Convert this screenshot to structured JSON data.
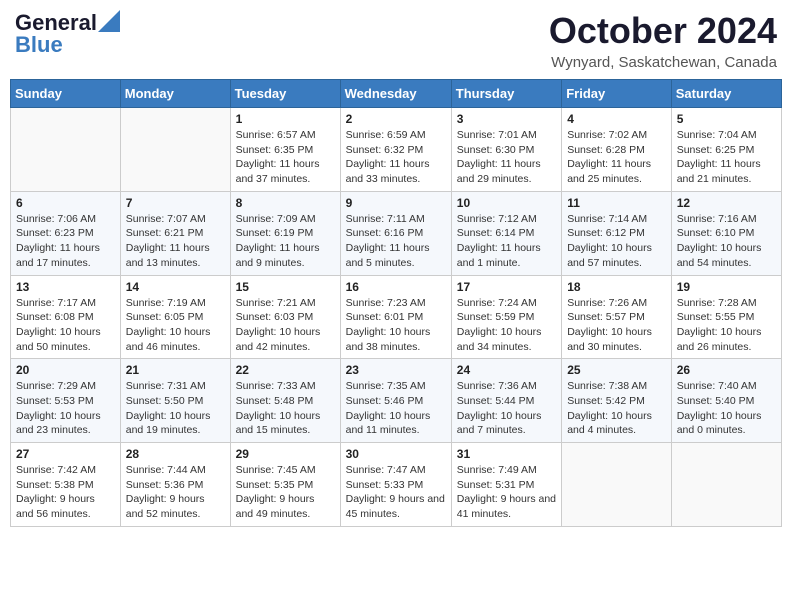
{
  "header": {
    "logo_general": "General",
    "logo_blue": "Blue",
    "month_title": "October 2024",
    "subtitle": "Wynyard, Saskatchewan, Canada"
  },
  "days_of_week": [
    "Sunday",
    "Monday",
    "Tuesday",
    "Wednesday",
    "Thursday",
    "Friday",
    "Saturday"
  ],
  "weeks": [
    [
      {
        "day": "",
        "info": ""
      },
      {
        "day": "",
        "info": ""
      },
      {
        "day": "1",
        "info": "Sunrise: 6:57 AM\nSunset: 6:35 PM\nDaylight: 11 hours and 37 minutes."
      },
      {
        "day": "2",
        "info": "Sunrise: 6:59 AM\nSunset: 6:32 PM\nDaylight: 11 hours and 33 minutes."
      },
      {
        "day": "3",
        "info": "Sunrise: 7:01 AM\nSunset: 6:30 PM\nDaylight: 11 hours and 29 minutes."
      },
      {
        "day": "4",
        "info": "Sunrise: 7:02 AM\nSunset: 6:28 PM\nDaylight: 11 hours and 25 minutes."
      },
      {
        "day": "5",
        "info": "Sunrise: 7:04 AM\nSunset: 6:25 PM\nDaylight: 11 hours and 21 minutes."
      }
    ],
    [
      {
        "day": "6",
        "info": "Sunrise: 7:06 AM\nSunset: 6:23 PM\nDaylight: 11 hours and 17 minutes."
      },
      {
        "day": "7",
        "info": "Sunrise: 7:07 AM\nSunset: 6:21 PM\nDaylight: 11 hours and 13 minutes."
      },
      {
        "day": "8",
        "info": "Sunrise: 7:09 AM\nSunset: 6:19 PM\nDaylight: 11 hours and 9 minutes."
      },
      {
        "day": "9",
        "info": "Sunrise: 7:11 AM\nSunset: 6:16 PM\nDaylight: 11 hours and 5 minutes."
      },
      {
        "day": "10",
        "info": "Sunrise: 7:12 AM\nSunset: 6:14 PM\nDaylight: 11 hours and 1 minute."
      },
      {
        "day": "11",
        "info": "Sunrise: 7:14 AM\nSunset: 6:12 PM\nDaylight: 10 hours and 57 minutes."
      },
      {
        "day": "12",
        "info": "Sunrise: 7:16 AM\nSunset: 6:10 PM\nDaylight: 10 hours and 54 minutes."
      }
    ],
    [
      {
        "day": "13",
        "info": "Sunrise: 7:17 AM\nSunset: 6:08 PM\nDaylight: 10 hours and 50 minutes."
      },
      {
        "day": "14",
        "info": "Sunrise: 7:19 AM\nSunset: 6:05 PM\nDaylight: 10 hours and 46 minutes."
      },
      {
        "day": "15",
        "info": "Sunrise: 7:21 AM\nSunset: 6:03 PM\nDaylight: 10 hours and 42 minutes."
      },
      {
        "day": "16",
        "info": "Sunrise: 7:23 AM\nSunset: 6:01 PM\nDaylight: 10 hours and 38 minutes."
      },
      {
        "day": "17",
        "info": "Sunrise: 7:24 AM\nSunset: 5:59 PM\nDaylight: 10 hours and 34 minutes."
      },
      {
        "day": "18",
        "info": "Sunrise: 7:26 AM\nSunset: 5:57 PM\nDaylight: 10 hours and 30 minutes."
      },
      {
        "day": "19",
        "info": "Sunrise: 7:28 AM\nSunset: 5:55 PM\nDaylight: 10 hours and 26 minutes."
      }
    ],
    [
      {
        "day": "20",
        "info": "Sunrise: 7:29 AM\nSunset: 5:53 PM\nDaylight: 10 hours and 23 minutes."
      },
      {
        "day": "21",
        "info": "Sunrise: 7:31 AM\nSunset: 5:50 PM\nDaylight: 10 hours and 19 minutes."
      },
      {
        "day": "22",
        "info": "Sunrise: 7:33 AM\nSunset: 5:48 PM\nDaylight: 10 hours and 15 minutes."
      },
      {
        "day": "23",
        "info": "Sunrise: 7:35 AM\nSunset: 5:46 PM\nDaylight: 10 hours and 11 minutes."
      },
      {
        "day": "24",
        "info": "Sunrise: 7:36 AM\nSunset: 5:44 PM\nDaylight: 10 hours and 7 minutes."
      },
      {
        "day": "25",
        "info": "Sunrise: 7:38 AM\nSunset: 5:42 PM\nDaylight: 10 hours and 4 minutes."
      },
      {
        "day": "26",
        "info": "Sunrise: 7:40 AM\nSunset: 5:40 PM\nDaylight: 10 hours and 0 minutes."
      }
    ],
    [
      {
        "day": "27",
        "info": "Sunrise: 7:42 AM\nSunset: 5:38 PM\nDaylight: 9 hours and 56 minutes."
      },
      {
        "day": "28",
        "info": "Sunrise: 7:44 AM\nSunset: 5:36 PM\nDaylight: 9 hours and 52 minutes."
      },
      {
        "day": "29",
        "info": "Sunrise: 7:45 AM\nSunset: 5:35 PM\nDaylight: 9 hours and 49 minutes."
      },
      {
        "day": "30",
        "info": "Sunrise: 7:47 AM\nSunset: 5:33 PM\nDaylight: 9 hours and 45 minutes."
      },
      {
        "day": "31",
        "info": "Sunrise: 7:49 AM\nSunset: 5:31 PM\nDaylight: 9 hours and 41 minutes."
      },
      {
        "day": "",
        "info": ""
      },
      {
        "day": "",
        "info": ""
      }
    ]
  ]
}
